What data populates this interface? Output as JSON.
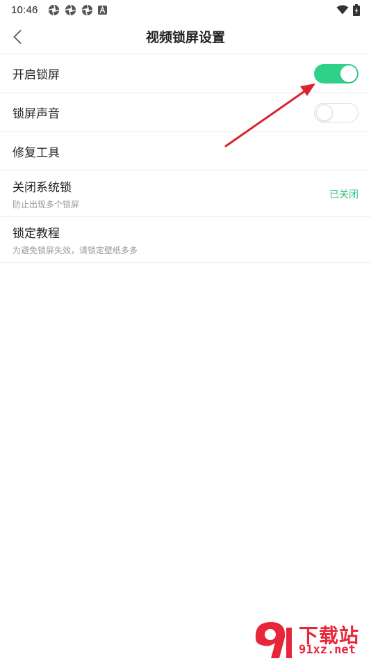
{
  "status_bar": {
    "time": "10:46",
    "left_icons": [
      "camera-shutter-icon",
      "camera-shutter-icon",
      "camera-shutter-icon",
      "a-letter-icon"
    ],
    "right_icons": [
      "wifi-icon",
      "battery-charging-icon"
    ]
  },
  "header": {
    "back_icon": "chevron-left-icon",
    "title": "视频锁屏设置"
  },
  "settings": [
    {
      "title": "开启锁屏",
      "control": "toggle",
      "enabled": true
    },
    {
      "title": "锁屏声音",
      "control": "toggle",
      "enabled": false
    },
    {
      "title": "修复工具"
    },
    {
      "title": "关闭系统锁",
      "subtitle": "防止出现多个锁屏",
      "value": "已关闭"
    },
    {
      "title": "锁定教程",
      "subtitle": "为避免锁屏失效，请锁定壁纸多多"
    }
  ],
  "watermark": {
    "logo_text": "9",
    "text": "下载站",
    "url": "91xz.net"
  },
  "colors": {
    "accent_green": "#2ed18a",
    "value_green": "#2ec27e",
    "arrow_red": "#d9232e",
    "watermark_red": "#e8263a"
  }
}
